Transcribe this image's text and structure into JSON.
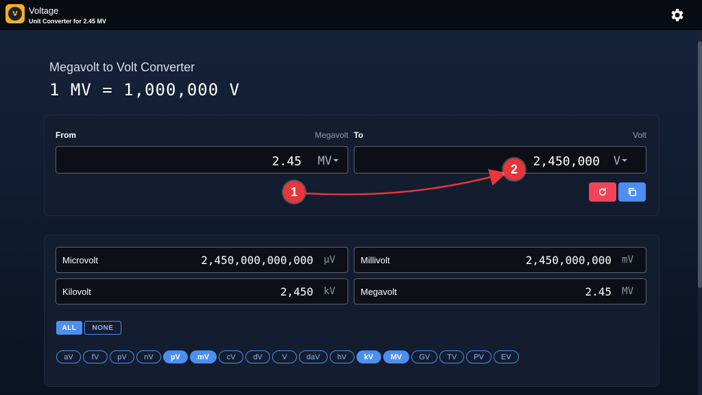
{
  "app": {
    "title": "Voltage",
    "subtitle": "Unit Converter for 2.45 MV",
    "logo_text": "V"
  },
  "heading": {
    "title": "Megavolt to Volt Converter",
    "equation": "1 MV = 1,000,000 V"
  },
  "converter": {
    "from_label": "From",
    "from_unit_name": "Megavolt",
    "from_value": "2.45",
    "from_unit": "MV",
    "to_label": "To",
    "to_unit_name": "Volt",
    "to_value": "2,450,000",
    "to_unit": "V"
  },
  "results": [
    {
      "name": "Microvolt",
      "value": "2,450,000,000,000",
      "unit": "µV"
    },
    {
      "name": "Millivolt",
      "value": "2,450,000,000",
      "unit": "mV"
    },
    {
      "name": "Kilovolt",
      "value": "2,450",
      "unit": "kV"
    },
    {
      "name": "Megavolt",
      "value": "2.45",
      "unit": "MV"
    }
  ],
  "toggles": {
    "all": "ALL",
    "none": "NONE"
  },
  "units": [
    {
      "label": "aV",
      "on": false
    },
    {
      "label": "fV",
      "on": false
    },
    {
      "label": "pV",
      "on": false
    },
    {
      "label": "nV",
      "on": false
    },
    {
      "label": "µV",
      "on": true
    },
    {
      "label": "mV",
      "on": true
    },
    {
      "label": "cV",
      "on": false
    },
    {
      "label": "dV",
      "on": false
    },
    {
      "label": "V",
      "on": false
    },
    {
      "label": "daV",
      "on": false
    },
    {
      "label": "hV",
      "on": false
    },
    {
      "label": "kV",
      "on": true
    },
    {
      "label": "MV",
      "on": true
    },
    {
      "label": "GV",
      "on": false
    },
    {
      "label": "TV",
      "on": false
    },
    {
      "label": "PV",
      "on": false
    },
    {
      "label": "EV",
      "on": false
    }
  ],
  "annotations": {
    "badge1": "1",
    "badge2": "2"
  },
  "colors": {
    "accent": "#4c8ff0",
    "reset": "#f0445a",
    "annotation": "#e8363a"
  },
  "icons": {
    "settings": "gear-icon",
    "reset": "refresh-icon",
    "copy": "copy-icon"
  }
}
